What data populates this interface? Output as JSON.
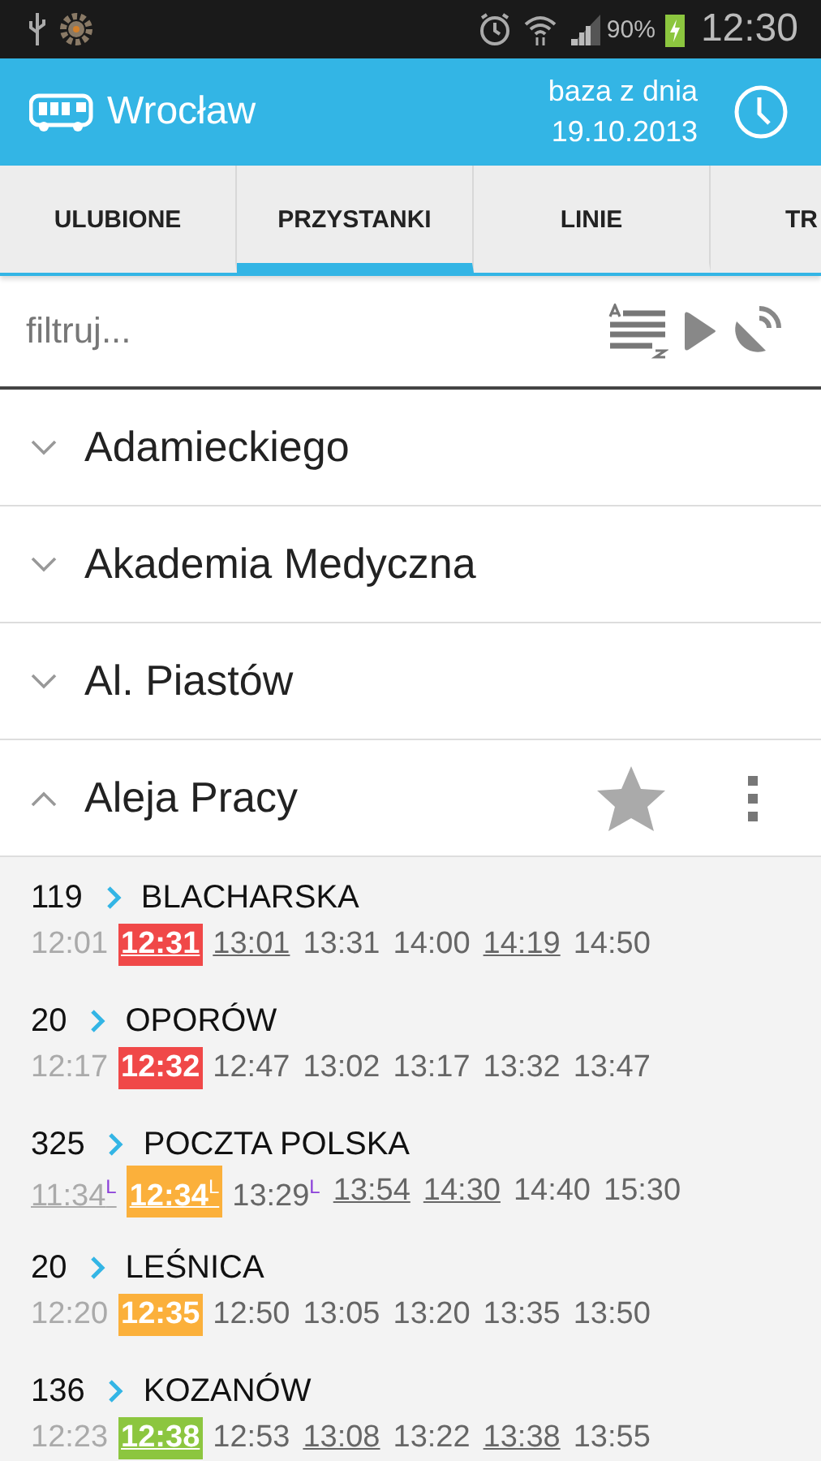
{
  "status_bar": {
    "battery": "90%",
    "time": "12:30"
  },
  "header": {
    "title": "Wrocław",
    "db_label": "baza z dnia",
    "db_date": "19.10.2013"
  },
  "tabs": [
    {
      "label": "ULUBIONE",
      "selected": false
    },
    {
      "label": "PRZYSTANKI",
      "selected": true
    },
    {
      "label": "LINIE",
      "selected": false
    },
    {
      "label": "TR",
      "selected": false
    }
  ],
  "filter": {
    "placeholder": "filtruj..."
  },
  "stops": [
    {
      "name": "Adamieckiego",
      "expanded": false
    },
    {
      "name": "Akademia Medyczna",
      "expanded": false
    },
    {
      "name": "Al. Piastów",
      "expanded": false
    },
    {
      "name": "Aleja Pracy",
      "expanded": true,
      "starred": false
    }
  ],
  "departures": [
    {
      "line": "119",
      "direction": "BLACHARSKA",
      "times": [
        {
          "text": "12:01",
          "kind": "past",
          "underlined": false
        },
        {
          "text": "12:31",
          "kind": "next",
          "underlined": true,
          "color": "#f04848"
        },
        {
          "text": "13:01",
          "kind": "future",
          "underlined": true
        },
        {
          "text": "13:31",
          "kind": "future",
          "underlined": false
        },
        {
          "text": "14:00",
          "kind": "future",
          "underlined": false
        },
        {
          "text": "14:19",
          "kind": "future",
          "underlined": true
        },
        {
          "text": "14:50",
          "kind": "future",
          "underlined": false
        }
      ]
    },
    {
      "line": "20",
      "direction": "OPORÓW",
      "times": [
        {
          "text": "12:17",
          "kind": "past",
          "underlined": false
        },
        {
          "text": "12:32",
          "kind": "next",
          "underlined": false,
          "color": "#f04848"
        },
        {
          "text": "12:47",
          "kind": "future",
          "underlined": false
        },
        {
          "text": "13:02",
          "kind": "future",
          "underlined": false
        },
        {
          "text": "13:17",
          "kind": "future",
          "underlined": false
        },
        {
          "text": "13:32",
          "kind": "future",
          "underlined": false
        },
        {
          "text": "13:47",
          "kind": "future",
          "underlined": false
        }
      ]
    },
    {
      "line": "325",
      "direction": "POCZTA POLSKA",
      "times": [
        {
          "text": "11:34$^{L}$",
          "kind": "past",
          "underlined": true
        },
        {
          "text": "12:34$^{L}$",
          "kind": "next",
          "underlined": true,
          "color": "#fbb03b"
        },
        {
          "text": "13:29$^{L}$",
          "kind": "future",
          "underlined": false
        },
        {
          "text": "13:54",
          "kind": "future",
          "underlined": true
        },
        {
          "text": "14:30",
          "kind": "future",
          "underlined": true
        },
        {
          "text": "14:40",
          "kind": "future",
          "underlined": false
        },
        {
          "text": "15:30",
          "kind": "future",
          "underlined": false
        }
      ]
    },
    {
      "line": "20",
      "direction": "LEŚNICA",
      "times": [
        {
          "text": "12:20",
          "kind": "past",
          "underlined": false
        },
        {
          "text": "12:35",
          "kind": "next",
          "underlined": false,
          "color": "#fbb03b"
        },
        {
          "text": "12:50",
          "kind": "future",
          "underlined": false
        },
        {
          "text": "13:05",
          "kind": "future",
          "underlined": false
        },
        {
          "text": "13:20",
          "kind": "future",
          "underlined": false
        },
        {
          "text": "13:35",
          "kind": "future",
          "underlined": false
        },
        {
          "text": "13:50",
          "kind": "future",
          "underlined": false
        }
      ]
    },
    {
      "line": "136",
      "direction": "KOZANÓW",
      "times": [
        {
          "text": "12:23",
          "kind": "past",
          "underlined": false
        },
        {
          "text": "12:38",
          "kind": "next",
          "underlined": true,
          "color": "#8cc63f"
        },
        {
          "text": "12:53",
          "kind": "future",
          "underlined": false
        },
        {
          "text": "13:08",
          "kind": "future",
          "underlined": true
        },
        {
          "text": "13:22",
          "kind": "future",
          "underlined": false
        },
        {
          "text": "13:38",
          "kind": "future",
          "underlined": true
        },
        {
          "text": "13:55",
          "kind": "future",
          "underlined": false
        }
      ]
    }
  ]
}
